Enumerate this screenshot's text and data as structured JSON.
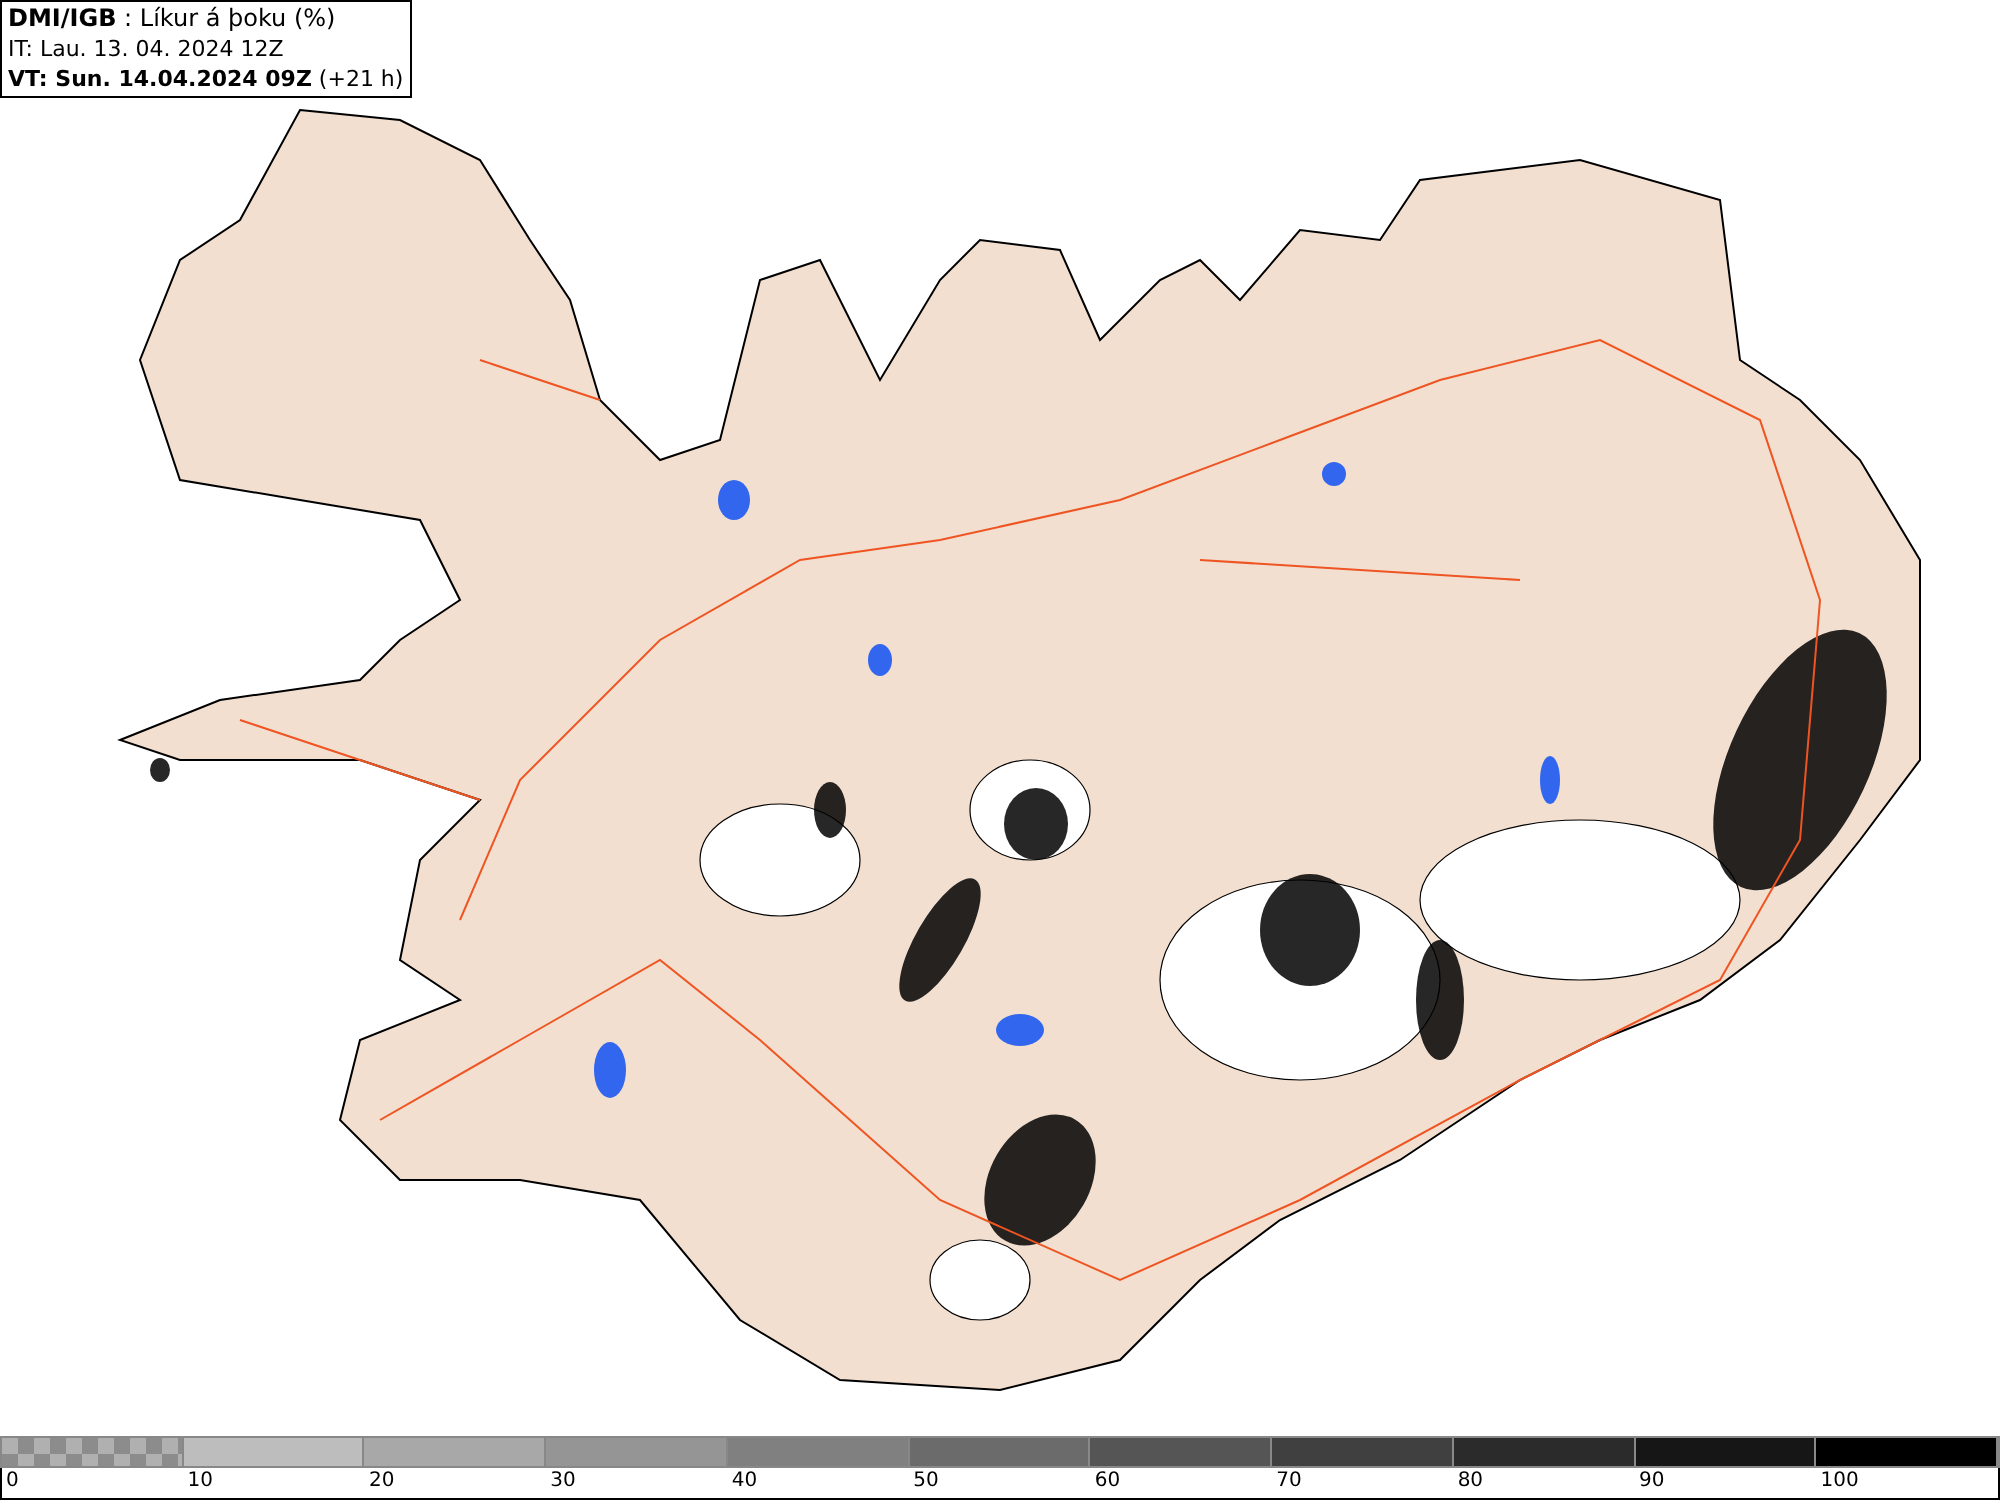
{
  "header": {
    "title": "**DMI/IGB** : Líkur á þoku (%)",
    "initial_time": "IT: Lau. 13. 04. 2024 12Z",
    "valid_time": "**VT: Sun. 14.04.2024 09Z** (+21 h)"
  },
  "legend": {
    "segments": [
      {
        "label": "0",
        "color": "#8c8c8c",
        "kind": "checkered"
      },
      {
        "label": "10",
        "color": "#bdbdbd",
        "kind": "solid"
      },
      {
        "label": "20",
        "color": "#a8a8a8",
        "kind": "solid"
      },
      {
        "label": "30",
        "color": "#959595",
        "kind": "solid"
      },
      {
        "label": "40",
        "color": "#808080",
        "kind": "solid"
      },
      {
        "label": "50",
        "color": "#6b6b6b",
        "kind": "solid"
      },
      {
        "label": "60",
        "color": "#555555",
        "kind": "solid"
      },
      {
        "label": "70",
        "color": "#404040",
        "kind": "solid"
      },
      {
        "label": "80",
        "color": "#2b2b2b",
        "kind": "solid"
      },
      {
        "label": "90",
        "color": "#161616",
        "kind": "solid"
      },
      {
        "label": "100",
        "color": "#000000",
        "kind": "solid"
      }
    ]
  }
}
